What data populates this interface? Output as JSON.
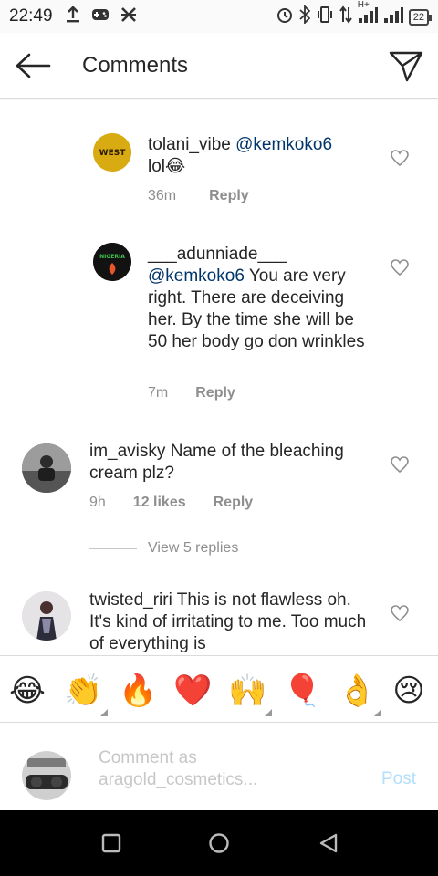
{
  "status_bar": {
    "time": "22:49",
    "battery": "22",
    "network": "H+"
  },
  "header": {
    "title": "Comments",
    "back_icon": "arrow-left-icon",
    "share_icon": "paper-plane-icon"
  },
  "comments": [
    {
      "username": "tolani_vibe",
      "mention": "@kemkoko6",
      "text": "lol😂",
      "time": "36m",
      "reply": "Reply"
    },
    {
      "username": "___adunniade___",
      "mention": "@kemkoko6",
      "text": "You are very right. There are deceiving her. By the time she will be 50 her body go don wrinkles",
      "time": "7m",
      "reply": "Reply"
    },
    {
      "username": "im_avisky",
      "text": "Name of the bleaching cream plz?",
      "time": "9h",
      "likes": "12 likes",
      "reply": "Reply"
    },
    {
      "username": "twisted_riri",
      "text": "This is not flawless oh. It's kind of irritating to me. Too much of everything is"
    }
  ],
  "view_replies": "View 5 replies",
  "emojis": [
    "😂",
    "👏",
    "🔥",
    "❤️",
    "🙌",
    "🎈",
    "👌",
    "😢"
  ],
  "input": {
    "placeholder": "Comment as aragold_cosmetics...",
    "post_label": "Post"
  },
  "colors": {
    "mention": "#003569",
    "meta": "#8e8e8e",
    "post": "#b2dffc",
    "heart": "#8e8e8e"
  }
}
